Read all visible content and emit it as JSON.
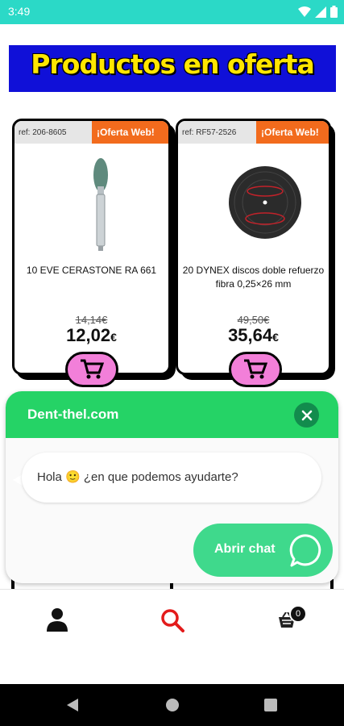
{
  "status_bar": {
    "time": "3:49"
  },
  "banner": {
    "title": "Productos en oferta",
    "title_color": "#ffe600",
    "background": "#1010d8"
  },
  "products": [
    {
      "ref": "ref: 206-8605",
      "offer_label": "¡Oferta Web!",
      "name": "10 EVE CERASTONE RA 661",
      "old_price": "14,14€",
      "new_price": "12,02",
      "currency": "€"
    },
    {
      "ref": "ref: RF57-2526",
      "offer_label": "¡Oferta Web!",
      "name": "20 DYNEX discos doble refuerzo fibra 0,25×26 mm",
      "old_price": "49,50€",
      "new_price": "35,64",
      "currency": "€"
    }
  ],
  "chat": {
    "title": "Dent-thel.com",
    "greeting": "Hola 🙂 ¿en que podemos ayudarte?",
    "open_button": "Abrir chat",
    "header_color": "#25d366"
  },
  "bottom_nav": {
    "cart_count": "0",
    "active_color": "#e31b1b"
  },
  "icons": [
    "wifi-icon",
    "signal-icon",
    "battery-icon",
    "cart-icon",
    "close-icon",
    "whatsapp-icon",
    "user-icon",
    "search-icon",
    "basket-icon",
    "back-icon",
    "home-icon",
    "recents-icon"
  ]
}
